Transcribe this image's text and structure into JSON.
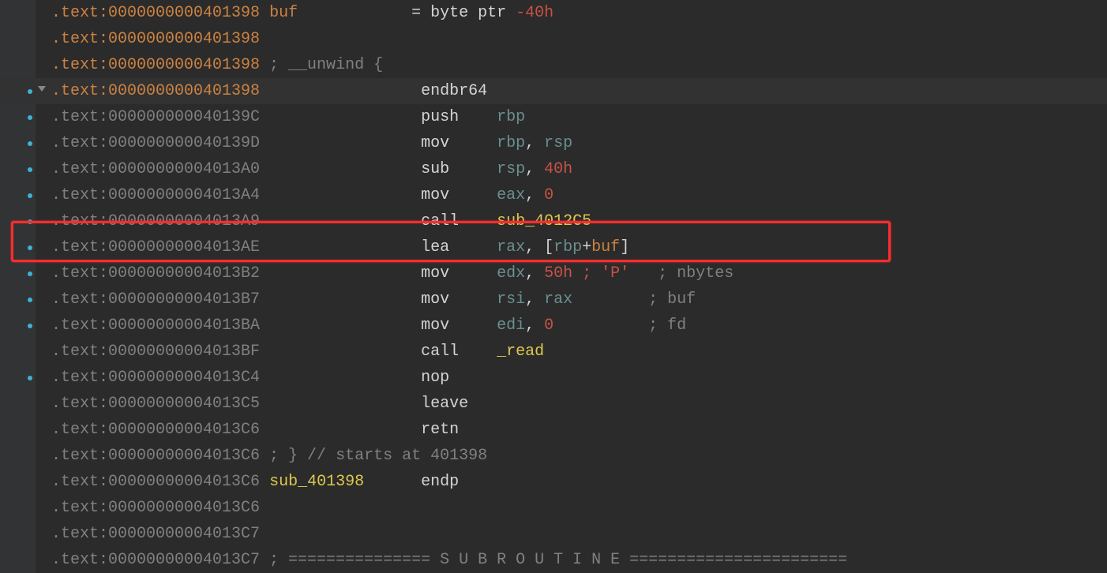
{
  "lines": [
    {
      "break": false,
      "expand": false,
      "orange": true,
      "highlight": false,
      "parts": [
        {
          "t": ".text:",
          "c": "seg-orange"
        },
        {
          "t": "0000000000401398",
          "c": "seg-orange"
        },
        {
          "t": " ",
          "c": "seg-white"
        },
        {
          "t": "buf",
          "c": "seg-orange"
        },
        {
          "t": "            = byte ptr ",
          "c": "seg-white"
        },
        {
          "t": "-40h",
          "c": "seg-num"
        }
      ]
    },
    {
      "break": false,
      "expand": false,
      "orange": true,
      "highlight": false,
      "parts": [
        {
          "t": ".text:",
          "c": "seg-orange"
        },
        {
          "t": "0000000000401398",
          "c": "seg-orange"
        }
      ]
    },
    {
      "break": false,
      "expand": false,
      "orange": true,
      "highlight": false,
      "parts": [
        {
          "t": ".text:",
          "c": "seg-orange"
        },
        {
          "t": "0000000000401398",
          "c": "seg-orange"
        },
        {
          "t": " ; __unwind {",
          "c": "seg-comment"
        }
      ]
    },
    {
      "break": true,
      "expand": true,
      "orange": true,
      "highlight": true,
      "parts": [
        {
          "t": ".text:",
          "c": "seg-orange"
        },
        {
          "t": "0000000000401398",
          "c": "seg-orange"
        },
        {
          "t": "                 endbr64",
          "c": "seg-white"
        }
      ]
    },
    {
      "break": true,
      "expand": false,
      "orange": false,
      "highlight": false,
      "parts": [
        {
          "t": ".text:",
          "c": "seg-grey"
        },
        {
          "t": "000000000040139C",
          "c": "seg-grey"
        },
        {
          "t": "                 push    ",
          "c": "seg-white"
        },
        {
          "t": "rbp",
          "c": "seg-reg"
        }
      ]
    },
    {
      "break": true,
      "expand": false,
      "orange": false,
      "highlight": false,
      "parts": [
        {
          "t": ".text:",
          "c": "seg-grey"
        },
        {
          "t": "000000000040139D",
          "c": "seg-grey"
        },
        {
          "t": "                 mov     ",
          "c": "seg-white"
        },
        {
          "t": "rbp",
          "c": "seg-reg"
        },
        {
          "t": ", ",
          "c": "seg-white"
        },
        {
          "t": "rsp",
          "c": "seg-reg"
        }
      ]
    },
    {
      "break": true,
      "expand": false,
      "orange": false,
      "highlight": false,
      "parts": [
        {
          "t": ".text:",
          "c": "seg-grey"
        },
        {
          "t": "00000000004013A0",
          "c": "seg-grey"
        },
        {
          "t": "                 sub     ",
          "c": "seg-white"
        },
        {
          "t": "rsp",
          "c": "seg-reg"
        },
        {
          "t": ", ",
          "c": "seg-white"
        },
        {
          "t": "40h",
          "c": "seg-num"
        }
      ]
    },
    {
      "break": true,
      "expand": false,
      "orange": false,
      "highlight": false,
      "parts": [
        {
          "t": ".text:",
          "c": "seg-grey"
        },
        {
          "t": "00000000004013A4",
          "c": "seg-grey"
        },
        {
          "t": "                 mov     ",
          "c": "seg-white"
        },
        {
          "t": "eax",
          "c": "seg-reg"
        },
        {
          "t": ", ",
          "c": "seg-white"
        },
        {
          "t": "0",
          "c": "seg-num"
        }
      ]
    },
    {
      "break": true,
      "expand": false,
      "orange": false,
      "highlight": false,
      "parts": [
        {
          "t": ".text:",
          "c": "seg-grey"
        },
        {
          "t": "00000000004013A9",
          "c": "seg-grey"
        },
        {
          "t": "                 call    ",
          "c": "seg-white"
        },
        {
          "t": "sub_4012C5",
          "c": "seg-func"
        }
      ]
    },
    {
      "break": true,
      "expand": false,
      "orange": false,
      "highlight": false,
      "parts": [
        {
          "t": ".text:",
          "c": "seg-grey"
        },
        {
          "t": "00000000004013AE",
          "c": "seg-grey"
        },
        {
          "t": "                 lea     ",
          "c": "seg-white"
        },
        {
          "t": "rax",
          "c": "seg-reg"
        },
        {
          "t": ", [",
          "c": "seg-white"
        },
        {
          "t": "rbp",
          "c": "seg-reg"
        },
        {
          "t": "+",
          "c": "seg-white"
        },
        {
          "t": "buf",
          "c": "seg-orange"
        },
        {
          "t": "]",
          "c": "seg-white"
        }
      ]
    },
    {
      "break": true,
      "expand": false,
      "orange": false,
      "highlight": false,
      "parts": [
        {
          "t": ".text:",
          "c": "seg-grey"
        },
        {
          "t": "00000000004013B2",
          "c": "seg-grey"
        },
        {
          "t": "                 mov     ",
          "c": "seg-white"
        },
        {
          "t": "edx",
          "c": "seg-reg"
        },
        {
          "t": ", ",
          "c": "seg-white"
        },
        {
          "t": "50h ; 'P'",
          "c": "seg-num"
        },
        {
          "t": "   ; nbytes",
          "c": "seg-comment"
        }
      ]
    },
    {
      "break": true,
      "expand": false,
      "orange": false,
      "highlight": false,
      "parts": [
        {
          "t": ".text:",
          "c": "seg-grey"
        },
        {
          "t": "00000000004013B7",
          "c": "seg-grey"
        },
        {
          "t": "                 mov     ",
          "c": "seg-white"
        },
        {
          "t": "rsi",
          "c": "seg-reg"
        },
        {
          "t": ", ",
          "c": "seg-white"
        },
        {
          "t": "rax",
          "c": "seg-reg"
        },
        {
          "t": "        ; buf",
          "c": "seg-comment"
        }
      ]
    },
    {
      "break": true,
      "expand": false,
      "orange": false,
      "highlight": false,
      "parts": [
        {
          "t": ".text:",
          "c": "seg-grey"
        },
        {
          "t": "00000000004013BA",
          "c": "seg-grey"
        },
        {
          "t": "                 mov     ",
          "c": "seg-white"
        },
        {
          "t": "edi",
          "c": "seg-reg"
        },
        {
          "t": ", ",
          "c": "seg-white"
        },
        {
          "t": "0",
          "c": "seg-num"
        },
        {
          "t": "          ; fd",
          "c": "seg-comment"
        }
      ]
    },
    {
      "break": false,
      "expand": false,
      "orange": false,
      "highlight": false,
      "parts": [
        {
          "t": ".text:",
          "c": "seg-grey"
        },
        {
          "t": "00000000004013BF",
          "c": "seg-grey"
        },
        {
          "t": "                 call    ",
          "c": "seg-white"
        },
        {
          "t": "_read",
          "c": "seg-func"
        }
      ]
    },
    {
      "break": true,
      "expand": false,
      "orange": false,
      "highlight": false,
      "parts": [
        {
          "t": ".text:",
          "c": "seg-grey"
        },
        {
          "t": "00000000004013C4",
          "c": "seg-grey"
        },
        {
          "t": "                 nop",
          "c": "seg-white"
        }
      ]
    },
    {
      "break": false,
      "expand": false,
      "orange": false,
      "highlight": false,
      "parts": [
        {
          "t": ".text:",
          "c": "seg-grey"
        },
        {
          "t": "00000000004013C5",
          "c": "seg-grey"
        },
        {
          "t": "                 leave",
          "c": "seg-white"
        }
      ]
    },
    {
      "break": false,
      "expand": false,
      "orange": false,
      "highlight": false,
      "parts": [
        {
          "t": ".text:",
          "c": "seg-grey"
        },
        {
          "t": "00000000004013C6",
          "c": "seg-grey"
        },
        {
          "t": "                 retn",
          "c": "seg-white"
        }
      ]
    },
    {
      "break": false,
      "expand": false,
      "orange": false,
      "highlight": false,
      "parts": [
        {
          "t": ".text:",
          "c": "seg-grey"
        },
        {
          "t": "00000000004013C6",
          "c": "seg-grey"
        },
        {
          "t": " ; } // starts at 401398",
          "c": "seg-comment"
        }
      ]
    },
    {
      "break": false,
      "expand": false,
      "orange": false,
      "highlight": false,
      "parts": [
        {
          "t": ".text:",
          "c": "seg-grey"
        },
        {
          "t": "00000000004013C6",
          "c": "seg-grey"
        },
        {
          "t": " ",
          "c": "seg-white"
        },
        {
          "t": "sub_401398",
          "c": "seg-func"
        },
        {
          "t": "      endp",
          "c": "seg-white"
        }
      ]
    },
    {
      "break": false,
      "expand": false,
      "orange": false,
      "highlight": false,
      "parts": [
        {
          "t": ".text:",
          "c": "seg-grey"
        },
        {
          "t": "00000000004013C6",
          "c": "seg-grey"
        }
      ]
    },
    {
      "break": false,
      "expand": false,
      "orange": false,
      "highlight": false,
      "parts": [
        {
          "t": ".text:",
          "c": "seg-grey"
        },
        {
          "t": "00000000004013C7",
          "c": "seg-grey"
        }
      ]
    },
    {
      "break": false,
      "expand": false,
      "orange": false,
      "highlight": false,
      "parts": [
        {
          "t": ".text:",
          "c": "seg-grey"
        },
        {
          "t": "00000000004013C7",
          "c": "seg-grey"
        },
        {
          "t": " ; =============== S U B R O U T I N E =======================",
          "c": "seg-comment"
        }
      ]
    }
  ]
}
